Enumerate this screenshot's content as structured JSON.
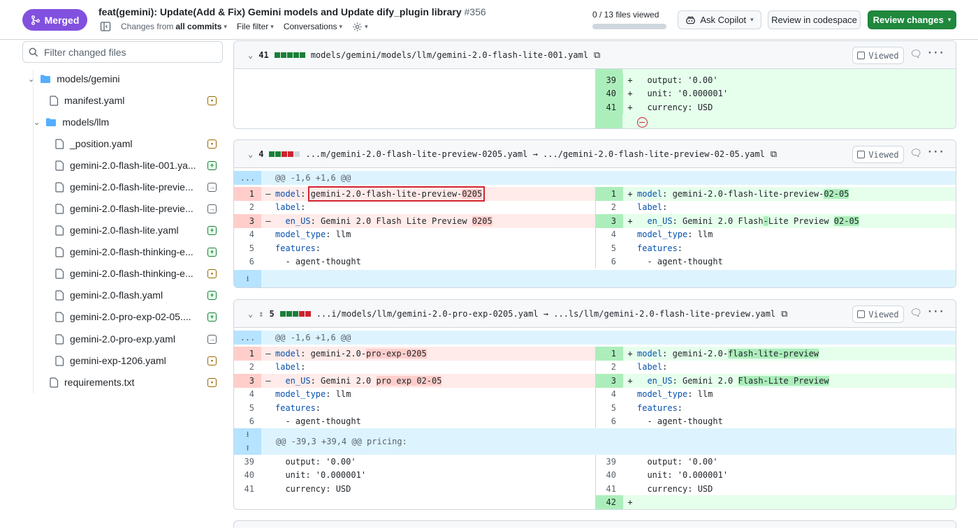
{
  "header": {
    "status_label": "Merged",
    "title": "feat(gemini): Update(Add & Fix) Gemini models and Update dify_plugin library",
    "pr_number": "#356",
    "changes_from_prefix": "Changes from",
    "changes_from_value": "all commits",
    "file_filter_label": "File filter",
    "conversations_label": "Conversations",
    "files_viewed": "0 / 13 files viewed",
    "ask_copilot_label": "Ask Copilot",
    "review_codespace_label": "Review in codespace",
    "review_changes_label": "Review changes"
  },
  "sidebar": {
    "filter_placeholder": "Filter changed files",
    "items": [
      {
        "label": "models/gemini",
        "kind": "folder",
        "status": ""
      },
      {
        "label": "manifest.yaml",
        "kind": "file",
        "status": "modified"
      },
      {
        "label": "models/llm",
        "kind": "folder",
        "status": ""
      },
      {
        "label": "_position.yaml",
        "kind": "file",
        "status": "modified"
      },
      {
        "label": "gemini-2.0-flash-lite-001.ya...",
        "kind": "file",
        "status": "added"
      },
      {
        "label": "gemini-2.0-flash-lite-previe...",
        "kind": "file",
        "status": "renamed"
      },
      {
        "label": "gemini-2.0-flash-lite-previe...",
        "kind": "file",
        "status": "renamed"
      },
      {
        "label": "gemini-2.0-flash-lite.yaml",
        "kind": "file",
        "status": "added"
      },
      {
        "label": "gemini-2.0-flash-thinking-e...",
        "kind": "file",
        "status": "added"
      },
      {
        "label": "gemini-2.0-flash-thinking-e...",
        "kind": "file",
        "status": "modified"
      },
      {
        "label": "gemini-2.0-flash.yaml",
        "kind": "file",
        "status": "added"
      },
      {
        "label": "gemini-2.0-pro-exp-02-05....",
        "kind": "file",
        "status": "added"
      },
      {
        "label": "gemini-2.0-pro-exp.yaml",
        "kind": "file",
        "status": "renamed"
      },
      {
        "label": "gemini-exp-1206.yaml",
        "kind": "file",
        "status": "modified"
      },
      {
        "label": "requirements.txt",
        "kind": "file",
        "status": "modified"
      }
    ]
  },
  "diffs": [
    {
      "count": "41",
      "path": "models/gemini/models/llm/gemini-2.0-flash-lite-001.yaml",
      "viewed_label": "Viewed",
      "rows": [
        {
          "rn": "39",
          "rcode": "  output: '0.00'"
        },
        {
          "rn": "40",
          "rcode": "  unit: '0.000001'"
        },
        {
          "rn": "41",
          "rcode": "  currency: USD"
        }
      ]
    },
    {
      "count": "4",
      "path": "...m/gemini-2.0-flash-lite-preview-0205.yaml → .../gemini-2.0-flash-lite-preview-02-05.yaml",
      "viewed_label": "Viewed",
      "hunk": "@@ -1,6 +1,6 @@",
      "hunk_expand": "...",
      "lines": {
        "l1_key": "model",
        "l1_pre": "gemini-2.0-flash-lite-preview-",
        "l1_hl": "0205",
        "r1_key": "model",
        "r1_pre": "gemini-2.0-flash-lite-preview-",
        "r1_hl": "02-05",
        "l2": "label",
        "l3_key": "en_US",
        "l3_pre": "Gemini 2.0 Flash",
        "l3_mid": " Lite Preview ",
        "l3_hl": "0205",
        "r3_pre": "Gemini 2.0 Flash",
        "r3_dash": "-",
        "r3_mid": "Lite Preview ",
        "r3_hl": "02-05",
        "l4_key": "model_type",
        "l4_val": "llm",
        "l5": "features",
        "l6": "- agent-thought"
      }
    },
    {
      "count": "5",
      "path": "...i/models/llm/gemini-2.0-pro-exp-0205.yaml → ...ls/llm/gemini-2.0-flash-lite-preview.yaml",
      "viewed_label": "Viewed",
      "hunk": "@@ -1,6 +1,6 @@",
      "hunk_expand": "...",
      "hunk2": "@@ -39,3 +39,4 @@ pricing:",
      "lines": {
        "l1_pre": "gemini-2.0-",
        "l1_hl": "pro-exp-0205",
        "r1_pre": "gemini-2.0-",
        "r1_hl": "flash-lite-preview",
        "l3_pre": "Gemini 2.0 ",
        "l3_hl": "pro exp 02-05",
        "r3_pre": "Gemini 2.0 ",
        "r3_hl": "Flash-Lite Preview",
        "p1": "output: '0.00'",
        "p2": "unit: '0.000001'",
        "p3": "currency: USD"
      }
    }
  ],
  "colors": {
    "merged": "#8250df",
    "primary_button": "#1f883d",
    "deletion": "#ffebe9",
    "addition": "#e6ffec",
    "hunk": "#ddf4ff"
  }
}
